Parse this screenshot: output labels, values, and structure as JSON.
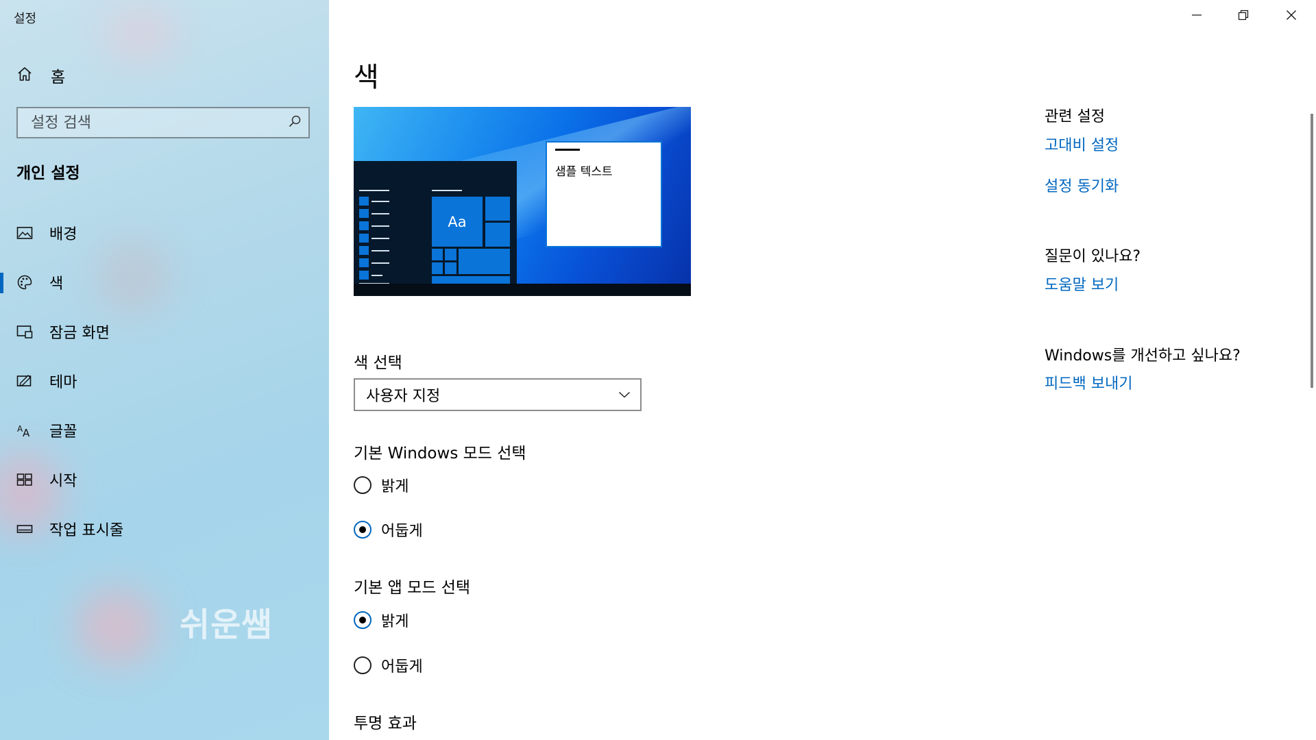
{
  "app": {
    "title": "설정"
  },
  "window_controls": {
    "minimize": "minimize-icon",
    "restore": "restore-icon",
    "close": "close-icon"
  },
  "sidebar": {
    "home_label": "홈",
    "search": {
      "placeholder": "설정 검색",
      "value": ""
    },
    "section_title": "개인 설정",
    "items": [
      {
        "label": "배경",
        "icon": "picture-icon",
        "selected": false
      },
      {
        "label": "색",
        "icon": "palette-icon",
        "selected": true
      },
      {
        "label": "잠금 화면",
        "icon": "lock-screen-icon",
        "selected": false
      },
      {
        "label": "테마",
        "icon": "theme-icon",
        "selected": false
      },
      {
        "label": "글꼴",
        "icon": "font-icon",
        "selected": false
      },
      {
        "label": "시작",
        "icon": "start-icon",
        "selected": false
      },
      {
        "label": "작업 표시줄",
        "icon": "taskbar-icon",
        "selected": false
      }
    ],
    "watermark": "쉬운쌤"
  },
  "main": {
    "title": "색",
    "preview": {
      "tile_text": "Aa",
      "sample_text": "샘플 텍스트"
    },
    "color_choice": {
      "label": "색 선택",
      "selected": "사용자 지정"
    },
    "windows_mode": {
      "label": "기본 Windows 모드 선택",
      "options": [
        {
          "label": "밝게",
          "checked": false
        },
        {
          "label": "어둡게",
          "checked": true
        }
      ]
    },
    "app_mode": {
      "label": "기본 앱 모드 선택",
      "options": [
        {
          "label": "밝게",
          "checked": true
        },
        {
          "label": "어둡게",
          "checked": false
        }
      ]
    },
    "transparency_label": "투명 효과"
  },
  "related": {
    "heading": "관련 설정",
    "links": [
      "고대비 설정",
      "설정 동기화"
    ],
    "question_heading": "질문이 있나요?",
    "help_link": "도움말 보기",
    "improve_heading": "Windows를 개선하고 싶나요?",
    "feedback_link": "피드백 보내기"
  },
  "colors": {
    "accent": "#0067c0",
    "preview_blue": "#0a74d8",
    "sidebar_bg": "#a6d4ea"
  }
}
